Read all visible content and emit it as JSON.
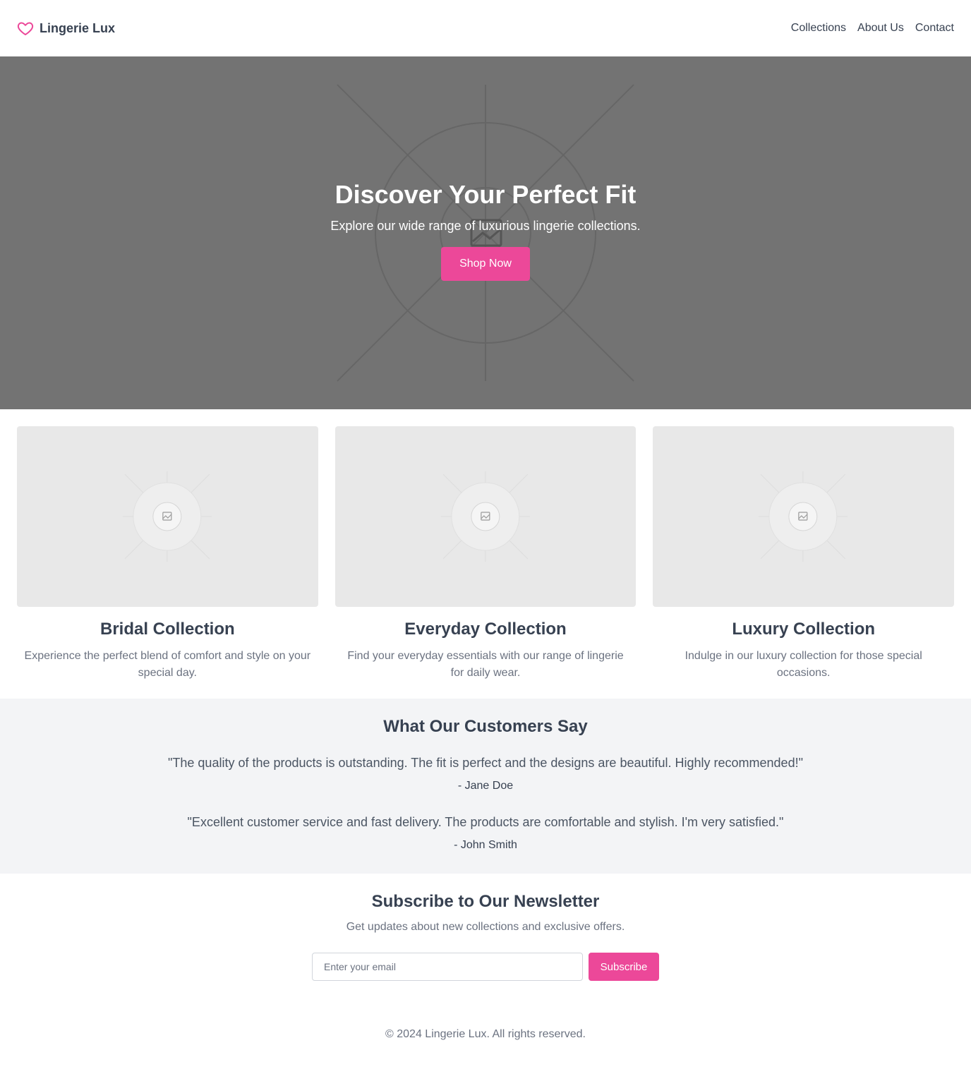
{
  "brand": {
    "name": "Lingerie Lux",
    "icon": "heart-icon",
    "accent_color": "#ec4899"
  },
  "nav": {
    "items": [
      "Collections",
      "About Us",
      "Contact"
    ]
  },
  "hero": {
    "title": "Discover Your Perfect Fit",
    "subtitle": "Explore our wide range of luxurious lingerie collections.",
    "cta_label": "Shop Now",
    "background_color": "#737373",
    "image_icon": "image-placeholder-icon"
  },
  "collections": [
    {
      "title": "Bridal Collection",
      "description": "Experience the perfect blend of comfort and style on your special day.",
      "image_icon": "image-placeholder-icon"
    },
    {
      "title": "Everyday Collection",
      "description": "Find your everyday essentials with our range of lingerie for daily wear.",
      "image_icon": "image-placeholder-icon"
    },
    {
      "title": "Luxury Collection",
      "description": "Indulge in our luxury collection for those special occasions.",
      "image_icon": "image-placeholder-icon"
    }
  ],
  "testimonials": {
    "title": "What Our Customers Say",
    "items": [
      {
        "quote": "\"The quality of the products is outstanding. The fit is perfect and the designs are beautiful. Highly recommended!\"",
        "author": "- Jane Doe"
      },
      {
        "quote": "\"Excellent customer service and fast delivery. The products are comfortable and stylish. I'm very satisfied.\"",
        "author": "- John Smith"
      }
    ]
  },
  "newsletter": {
    "title": "Subscribe to Our Newsletter",
    "subtitle": "Get updates about new collections and exclusive offers.",
    "email_placeholder": "Enter your email",
    "email_value": "",
    "button_label": "Subscribe"
  },
  "footer": {
    "copyright": "© 2024 Lingerie Lux. All rights reserved."
  }
}
